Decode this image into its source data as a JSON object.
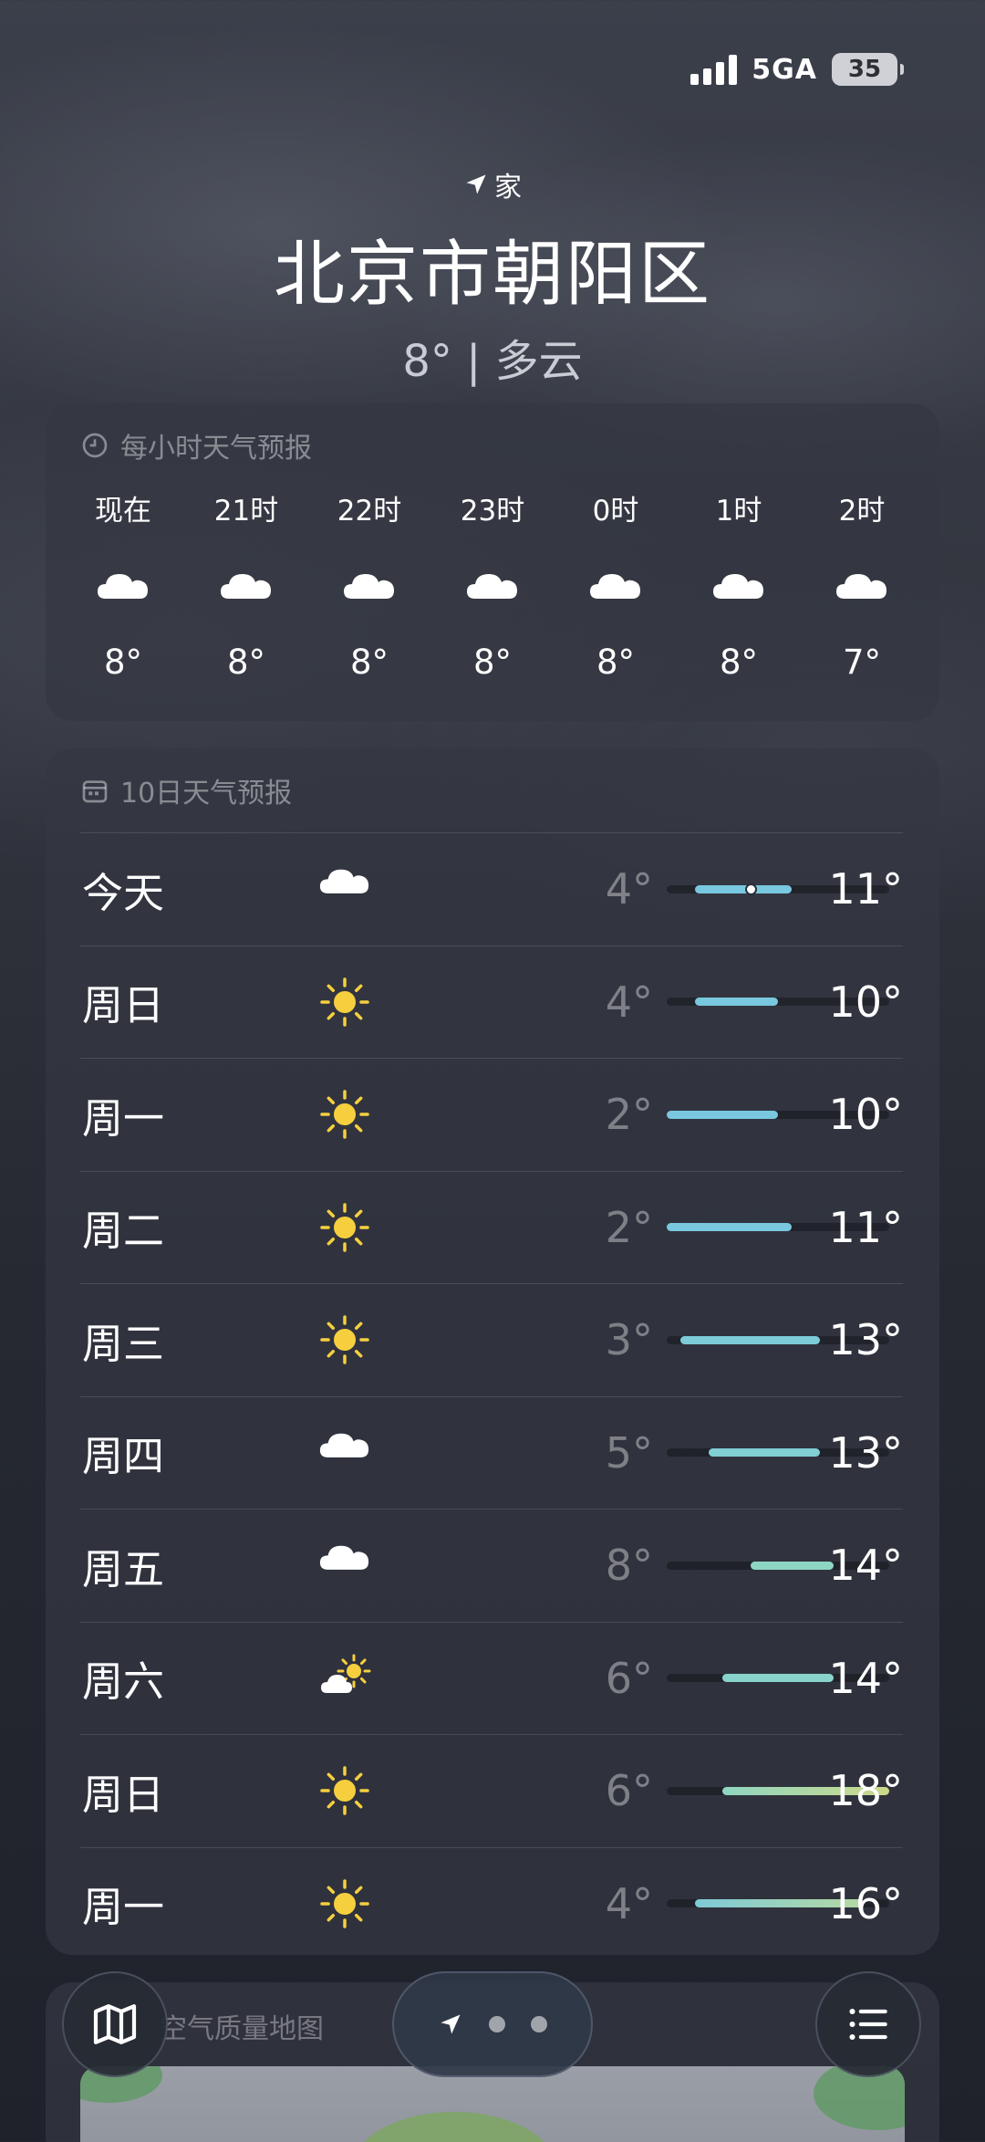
{
  "status": {
    "network": "5GA",
    "battery": "35"
  },
  "header": {
    "location_label": "家",
    "city": "北京市朝阳区",
    "current": "8° | 多云"
  },
  "hourly": {
    "title": "每小时天气预报",
    "items": [
      {
        "time": "现在",
        "icon": "cloud-icon",
        "temp": "8°"
      },
      {
        "time": "21时",
        "icon": "cloud-icon",
        "temp": "8°"
      },
      {
        "time": "22时",
        "icon": "cloud-icon",
        "temp": "8°"
      },
      {
        "time": "23时",
        "icon": "cloud-icon",
        "temp": "8°"
      },
      {
        "time": "0时",
        "icon": "cloud-icon",
        "temp": "8°"
      },
      {
        "time": "1时",
        "icon": "cloud-icon",
        "temp": "8°"
      },
      {
        "time": "2时",
        "icon": "cloud-icon",
        "temp": "7°"
      }
    ]
  },
  "daily": {
    "title": "10日天气预报",
    "range": [
      2,
      18
    ],
    "current_temp": 8,
    "items": [
      {
        "day": "今天",
        "icon": "cloud-icon",
        "low": "4°",
        "high": "11°",
        "lo": 4,
        "hi": 11,
        "color": "#79c8df",
        "current": true
      },
      {
        "day": "周日",
        "icon": "sun-icon",
        "low": "4°",
        "high": "10°",
        "lo": 4,
        "hi": 10,
        "color": "#79c8df"
      },
      {
        "day": "周一",
        "icon": "sun-icon",
        "low": "2°",
        "high": "10°",
        "lo": 2,
        "hi": 10,
        "color": "#79c8df"
      },
      {
        "day": "周二",
        "icon": "sun-icon",
        "low": "2°",
        "high": "11°",
        "lo": 2,
        "hi": 11,
        "color": "#79c8df"
      },
      {
        "day": "周三",
        "icon": "sun-icon",
        "low": "3°",
        "high": "13°",
        "lo": 3,
        "hi": 13,
        "color": "#7cccd8"
      },
      {
        "day": "周四",
        "icon": "cloud-icon",
        "low": "5°",
        "high": "13°",
        "lo": 5,
        "hi": 13,
        "color": "#80d0d4"
      },
      {
        "day": "周五",
        "icon": "cloud-icon",
        "low": "8°",
        "high": "14°",
        "lo": 8,
        "hi": 14,
        "color": "#8ed6c4"
      },
      {
        "day": "周六",
        "icon": "partly-sunny-icon",
        "low": "6°",
        "high": "14°",
        "lo": 6,
        "hi": 14,
        "color": "#88d4cc"
      },
      {
        "day": "周日",
        "icon": "sun-icon",
        "low": "6°",
        "high": "18°",
        "lo": 6,
        "hi": 18,
        "color": "#8fd6c2",
        "color_end": "#cdd88a"
      },
      {
        "day": "周一",
        "icon": "sun-icon",
        "low": "4°",
        "high": "16°",
        "lo": 4,
        "hi": 16,
        "color": "#7ecad8",
        "color_end": "#b4d8a4"
      }
    ]
  },
  "map_card": {
    "title": "空气质量地图"
  },
  "nav": {
    "map_icon": "map-icon",
    "list_icon": "list-icon",
    "location_icon": "location-arrow-icon"
  }
}
